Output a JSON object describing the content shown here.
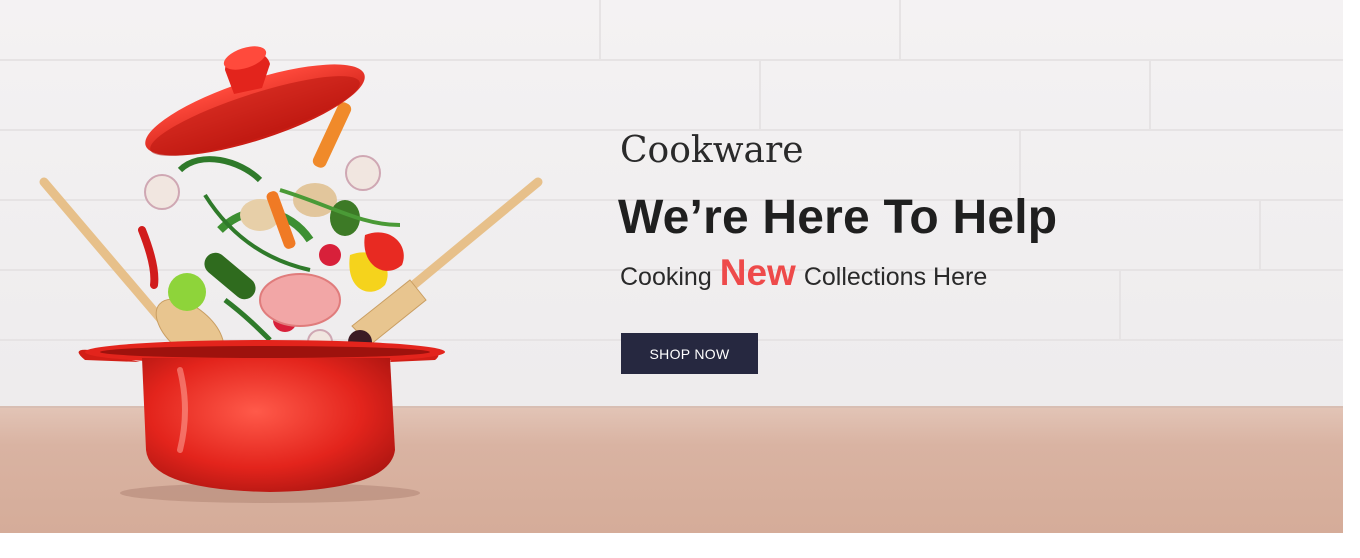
{
  "hero": {
    "brand_title": "Cookware",
    "headline": "We’re Here To Help",
    "tagline_before": "Cooking",
    "tagline_highlight": "New",
    "tagline_after": "Collections Here",
    "cta_label": "SHOP NOW"
  },
  "colors": {
    "accent": "#ee4a4a",
    "button_bg": "#262840",
    "pot_red": "#e3241c"
  }
}
